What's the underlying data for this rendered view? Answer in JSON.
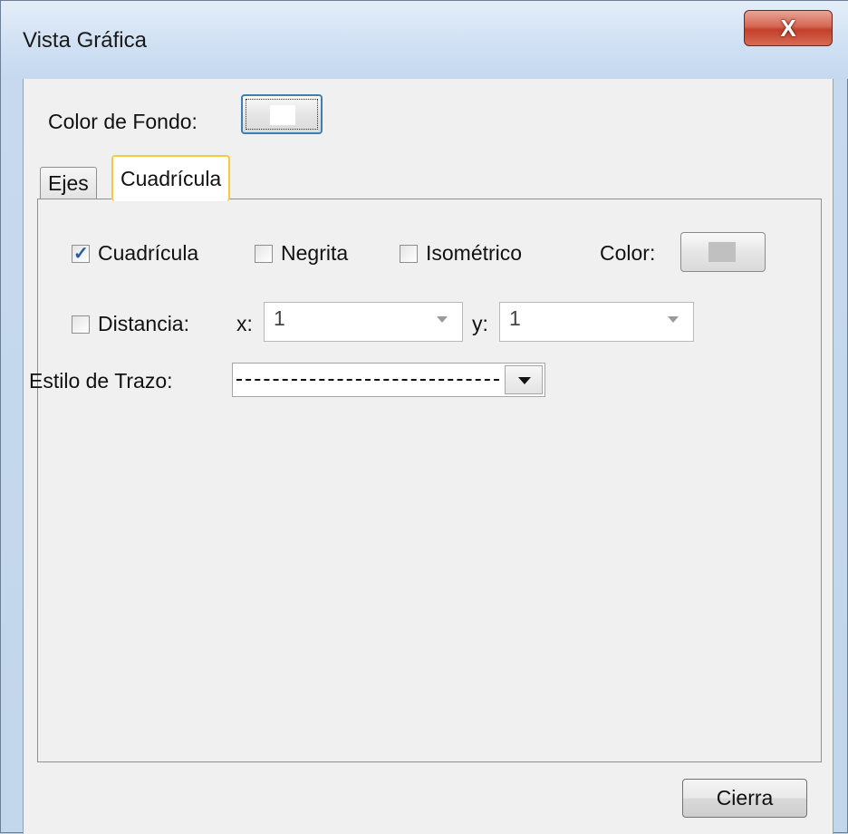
{
  "window": {
    "title": "Vista Gráfica",
    "close_glyph": "X"
  },
  "background": {
    "label": "Color de Fondo:",
    "swatch_color": "#ffffff"
  },
  "tabs": [
    {
      "label": "Ejes",
      "active": false
    },
    {
      "label": "Cuadrícula",
      "active": true
    }
  ],
  "grid_panel": {
    "show_grid": {
      "label": "Cuadrícula",
      "checked": true
    },
    "bold": {
      "label": "Negrita",
      "checked": false
    },
    "isometric": {
      "label": "Isométrico",
      "checked": false
    },
    "color_label": "Color:",
    "grid_color": "#c0c0c0",
    "distance": {
      "label": "Distancia:",
      "checked": false
    },
    "x_label": "x:",
    "x_value": "1",
    "y_label": "y:",
    "y_value": "1",
    "line_style_label": "Estilo de Trazo:",
    "line_style": "dashed"
  },
  "footer": {
    "close_label": "Cierra"
  },
  "icons": [
    "close-icon",
    "dropdown-arrow-icon",
    "checkbox-check-icon"
  ],
  "colors": {
    "titlebar": "#cfe0f3",
    "close_button": "#c2402b",
    "focus": "#3c7fb1",
    "active_tab_border": "#f5c940"
  }
}
